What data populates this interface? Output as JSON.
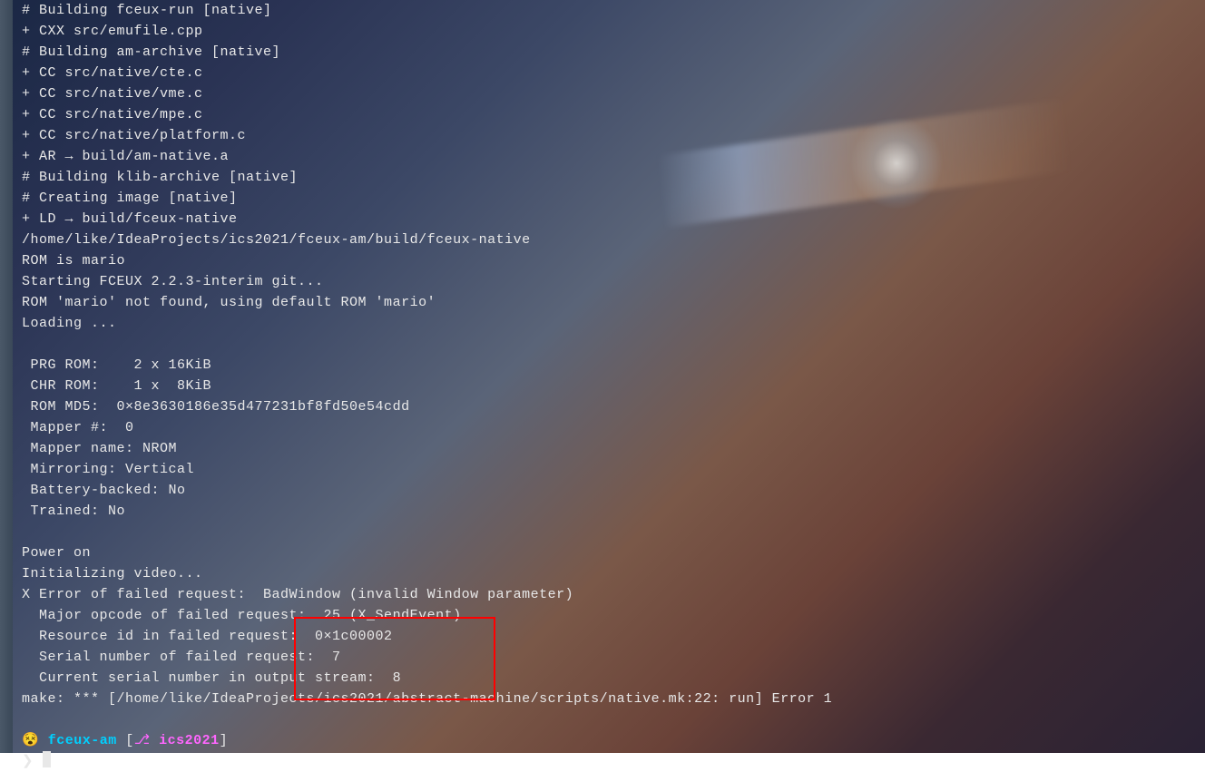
{
  "terminal": {
    "lines": [
      "# Building fceux-run [native]",
      "+ CXX src/emufile.cpp",
      "# Building am-archive [native]",
      "+ CC src/native/cte.c",
      "+ CC src/native/vme.c",
      "+ CC src/native/mpe.c",
      "+ CC src/native/platform.c",
      "+ AR → build/am-native.a",
      "# Building klib-archive [native]",
      "# Creating image [native]",
      "+ LD → build/fceux-native",
      "/home/like/IdeaProjects/ics2021/fceux-am/build/fceux-native",
      "ROM is mario",
      "Starting FCEUX 2.2.3-interim git...",
      "ROM 'mario' not found, using default ROM 'mario'",
      "Loading ...",
      "",
      " PRG ROM:    2 x 16KiB",
      " CHR ROM:    1 x  8KiB",
      " ROM MD5:  0×8e3630186e35d477231bf8fd50e54cdd",
      " Mapper #:  0",
      " Mapper name: NROM",
      " Mirroring: Vertical",
      " Battery-backed: No",
      " Trained: No",
      "",
      "Power on",
      "Initializing video...",
      "X Error of failed request:  BadWindow (invalid Window parameter)",
      "  Major opcode of failed request:  25 (X_SendEvent)",
      "  Resource id in failed request:  0×1c00002",
      "  Serial number of failed request:  7",
      "  Current serial number in output stream:  8",
      "make: *** [/home/like/IdeaProjects/ics2021/abstract-machine/scripts/native.mk:22: run] Error 1",
      ""
    ]
  },
  "prompt": {
    "emoji": "😵",
    "dir": "fceux-am",
    "branch_icon": "⎇",
    "branch": "ics2021",
    "cursor_prefix": "❯ "
  }
}
